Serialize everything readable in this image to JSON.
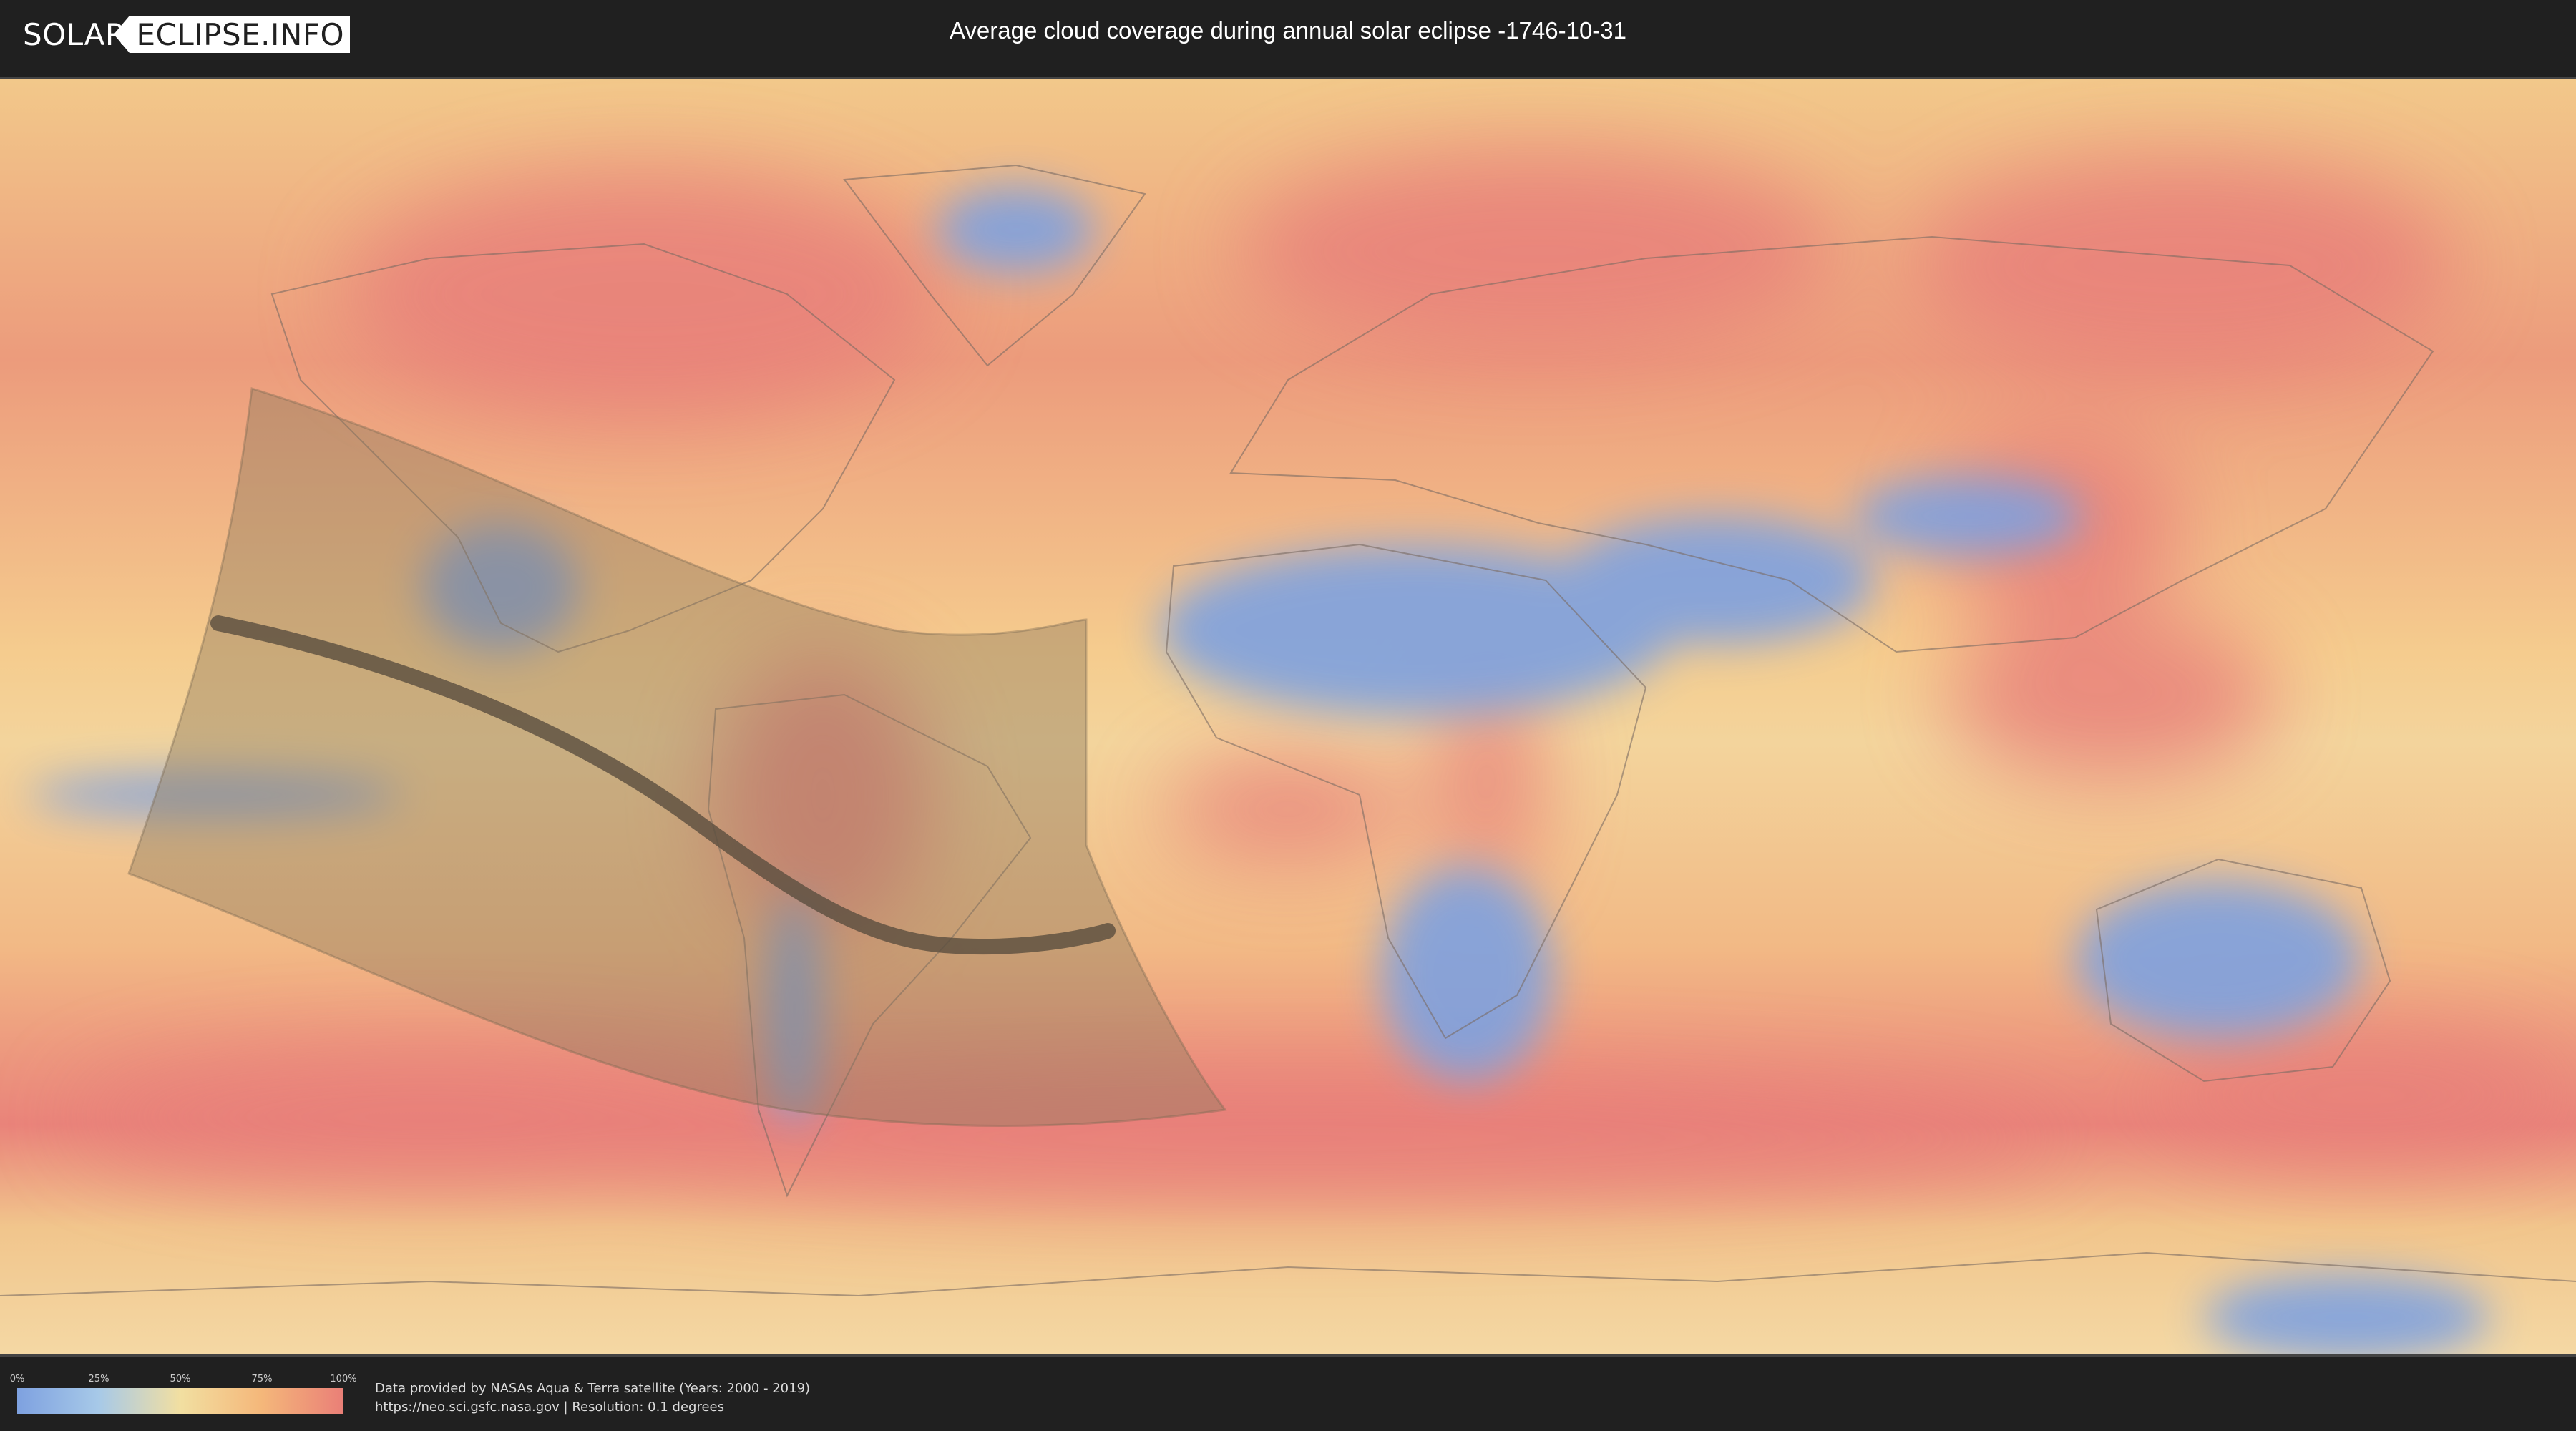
{
  "header": {
    "logo_solar": "SOLAR",
    "logo_eclipse": "ECLIPSE.INFO",
    "title": "Average cloud coverage during annual solar eclipse -1746-10-31"
  },
  "map": {
    "projection": "equirectangular",
    "layer": "average cloud coverage",
    "eclipse_type": "annular",
    "eclipse_date": "-1746-10-31",
    "colors": {
      "ocean_base": "#f4c587",
      "high_cloud": "#e8807a",
      "low_cloud": "#7ea1e0",
      "penumbra_shade": "#8c7a5e",
      "central_line": "#5a4e3e"
    }
  },
  "legend": {
    "ticks": [
      "0%",
      "25%",
      "50%",
      "75%",
      "100%"
    ],
    "gradient": [
      "#7ea1e0",
      "#a7c9e8",
      "#f2dfa1",
      "#f4b77a",
      "#ea7f77"
    ]
  },
  "credits": {
    "line1": "Data provided by NASAs Aqua & Terra satellite (Years: 2000 - 2019)",
    "line2": "https://neo.sci.gsfc.nasa.gov | Resolution: 0.1 degrees"
  }
}
